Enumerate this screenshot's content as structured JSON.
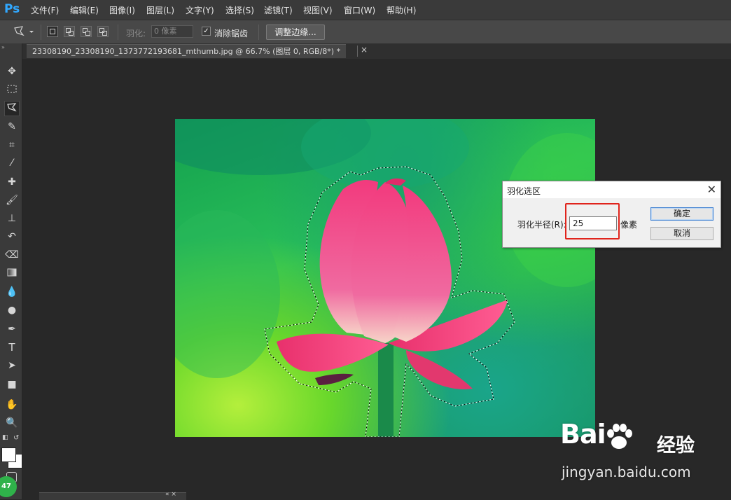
{
  "app": {
    "logo": "Ps"
  },
  "menu": [
    "文件(F)",
    "编辑(E)",
    "图像(I)",
    "图层(L)",
    "文字(Y)",
    "选择(S)",
    "滤镜(T)",
    "视图(V)",
    "窗口(W)",
    "帮助(H)"
  ],
  "options": {
    "feather_label": "羽化:",
    "feather_value": "0 像素",
    "antialias_checked": true,
    "antialias_label": "消除锯齿",
    "refine_edge_label": "调整边缘..."
  },
  "document": {
    "tab_title": "23308190_23308190_1373772193681_mthumb.jpg @ 66.7% (图层 0, RGB/8*) *"
  },
  "dialog": {
    "title": "羽化选区",
    "radius_label": "羽化半径(R):",
    "radius_value": "25",
    "unit": "像素",
    "ok_label": "确定",
    "cancel_label": "取消"
  },
  "watermark": {
    "bai": "Bai",
    "du": "du",
    "jingyan": "经验",
    "url": "jingyan.baidu.com"
  },
  "badge_text": "47",
  "colors": {
    "highlight": "#e0241c",
    "ps_blue": "#31a8ff",
    "lotus_pink": "#f0407a"
  }
}
